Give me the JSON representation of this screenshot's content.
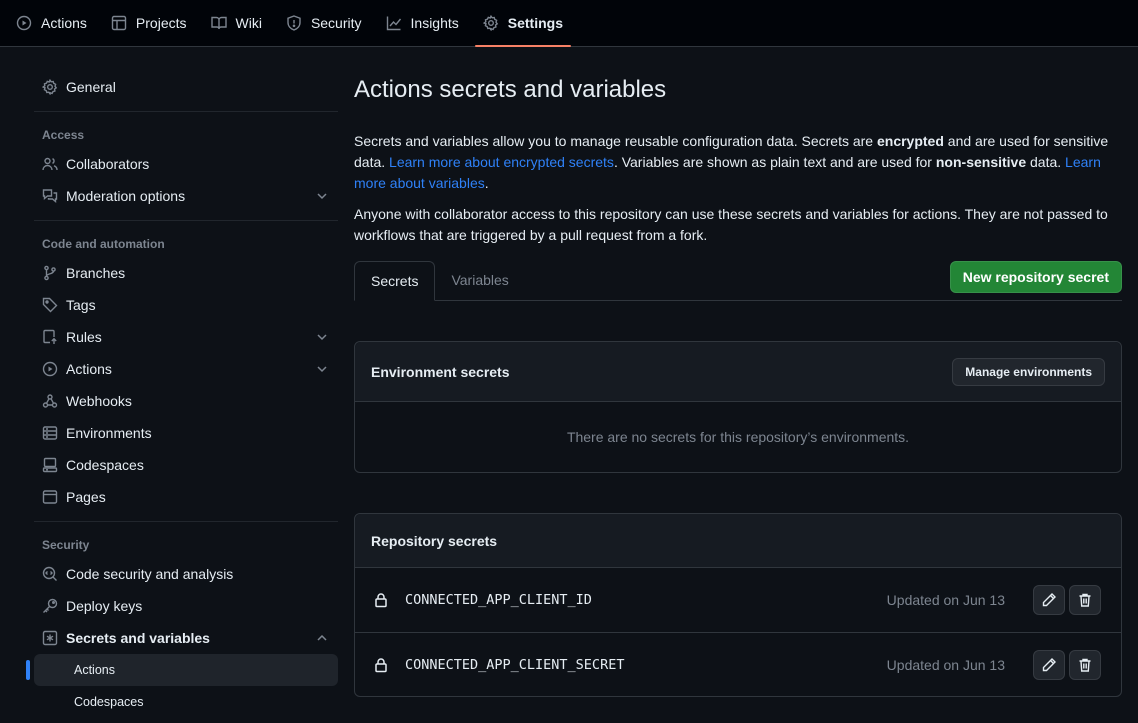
{
  "topnav": {
    "items": [
      {
        "label": "Actions",
        "icon": "play-icon"
      },
      {
        "label": "Projects",
        "icon": "table-icon"
      },
      {
        "label": "Wiki",
        "icon": "book-icon"
      },
      {
        "label": "Security",
        "icon": "shield-icon"
      },
      {
        "label": "Insights",
        "icon": "graph-icon"
      },
      {
        "label": "Settings",
        "icon": "gear-icon",
        "active": true
      }
    ]
  },
  "sidebar": {
    "general": "General",
    "access_heading": "Access",
    "collaborators": "Collaborators",
    "moderation": "Moderation options",
    "code_heading": "Code and automation",
    "branches": "Branches",
    "tags": "Tags",
    "rules": "Rules",
    "actions": "Actions",
    "webhooks": "Webhooks",
    "environments": "Environments",
    "codespaces": "Codespaces",
    "pages": "Pages",
    "security_heading": "Security",
    "code_security": "Code security and analysis",
    "deploy_keys": "Deploy keys",
    "secrets_vars": "Secrets and variables",
    "sub_actions": "Actions",
    "sub_codespaces": "Codespaces"
  },
  "main": {
    "title": "Actions secrets and variables",
    "desc": {
      "p1": "Secrets and variables allow you to manage reusable configuration data. Secrets are ",
      "b1": "encrypted",
      "p2": " and are used for sensitive data. ",
      "link1": "Learn more about encrypted secrets",
      "p3": ". Variables are shown as plain text and are used for ",
      "b2": "non-sensitive",
      "p4": " data. ",
      "link2": "Learn more about variables",
      "p5": "."
    },
    "desc2": "Anyone with collaborator access to this repository can use these secrets and variables for actions. They are not passed to workflows that are triggered by a pull request from a fork.",
    "tabs": [
      {
        "label": "Secrets",
        "active": true
      },
      {
        "label": "Variables",
        "active": false
      }
    ],
    "new_secret_button": "New repository secret",
    "env_box": {
      "title": "Environment secrets",
      "manage_button": "Manage environments",
      "empty_text": "There are no secrets for this repository’s environments."
    },
    "repo_box": {
      "title": "Repository secrets",
      "secrets": [
        {
          "name": "CONNECTED_APP_CLIENT_ID",
          "updated": "Updated on Jun 13"
        },
        {
          "name": "CONNECTED_APP_CLIENT_SECRET",
          "updated": "Updated on Jun 13"
        }
      ]
    }
  },
  "colors": {
    "background": "#0d1117",
    "accent_blue": "#2f81f7",
    "primary_green": "#238636",
    "active_tab_underline": "#f78166"
  }
}
